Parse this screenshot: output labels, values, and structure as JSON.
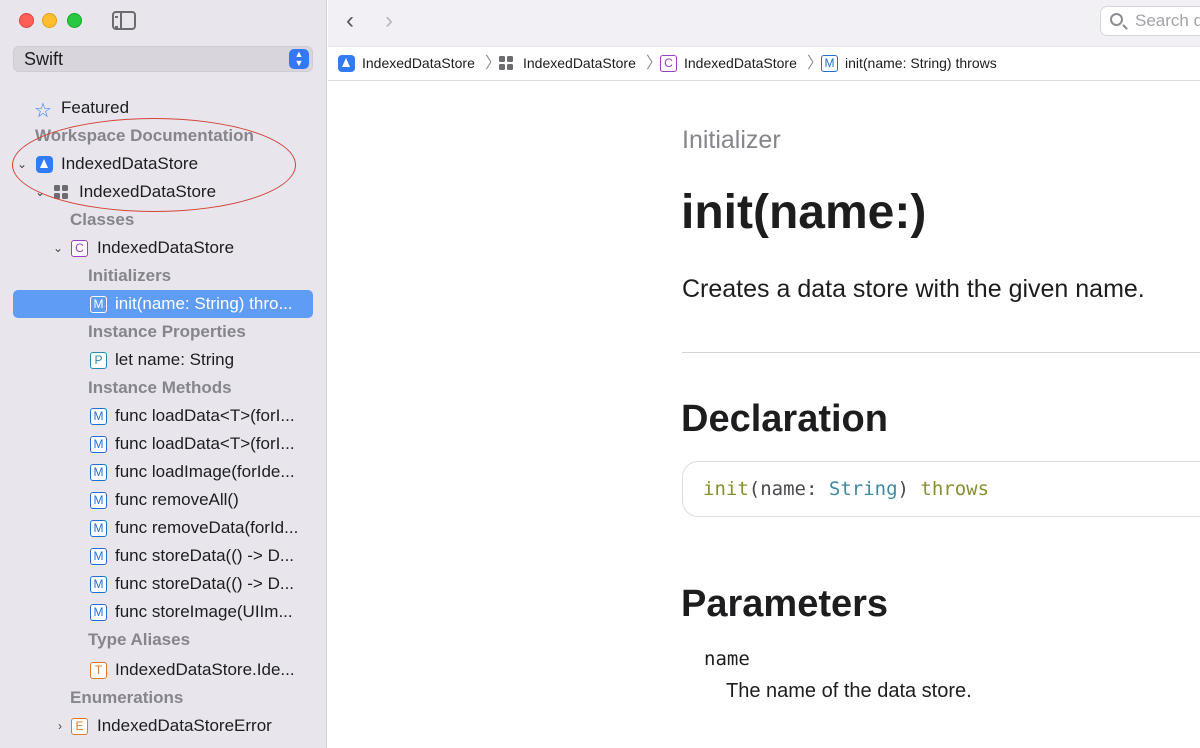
{
  "sidebar": {
    "language": "Swift",
    "rows": [
      {
        "kind": "featured",
        "label": "Featured"
      },
      {
        "kind": "header",
        "label": "Workspace Documentation"
      },
      {
        "kind": "app",
        "label": "IndexedDataStore"
      },
      {
        "kind": "module",
        "label": "IndexedDataStore"
      },
      {
        "kind": "header",
        "label": "Classes"
      },
      {
        "kind": "class",
        "icon": "C",
        "label": "IndexedDataStore"
      },
      {
        "kind": "header",
        "label": "Initializers"
      },
      {
        "kind": "method",
        "icon": "M",
        "label": "init(name: String) thro..."
      },
      {
        "kind": "header",
        "label": "Instance Properties"
      },
      {
        "kind": "property",
        "icon": "P",
        "label": "let name: String"
      },
      {
        "kind": "header",
        "label": "Instance Methods"
      },
      {
        "kind": "method",
        "icon": "M",
        "label": "func loadData<T>(forI..."
      },
      {
        "kind": "method",
        "icon": "M",
        "label": "func loadData<T>(forI..."
      },
      {
        "kind": "method",
        "icon": "M",
        "label": "func loadImage(forIde..."
      },
      {
        "kind": "method",
        "icon": "M",
        "label": "func removeAll()"
      },
      {
        "kind": "method",
        "icon": "M",
        "label": "func removeData(forId..."
      },
      {
        "kind": "method",
        "icon": "M",
        "label": "func storeData(() -> D..."
      },
      {
        "kind": "method",
        "icon": "M",
        "label": "func storeData(() -> D..."
      },
      {
        "kind": "method",
        "icon": "M",
        "label": "func storeImage(UIIm..."
      },
      {
        "kind": "header",
        "label": "Type Aliases"
      },
      {
        "kind": "typealias",
        "icon": "T",
        "label": "IndexedDataStore.Ide..."
      },
      {
        "kind": "header",
        "label": "Enumerations"
      },
      {
        "kind": "enum",
        "icon": "E",
        "label": "IndexedDataStoreError"
      }
    ]
  },
  "toolbar": {
    "back": "‹",
    "forward": "›",
    "search_placeholder": "Search d"
  },
  "breadcrumb": [
    {
      "icon": "app",
      "label": "IndexedDataStore"
    },
    {
      "icon": "module",
      "label": "IndexedDataStore"
    },
    {
      "icon": "C",
      "label": "IndexedDataStore"
    },
    {
      "icon": "M",
      "label": "init(name: String) throws"
    }
  ],
  "content": {
    "kind": "Initializer",
    "title": "init(name:)",
    "abstract": "Creates a data store with the given name.",
    "declaration_heading": "Declaration",
    "declaration": {
      "init": "init",
      "open": "(",
      "param": "name",
      "colon": ": ",
      "type": "String",
      "close": ")",
      "throws": "throws"
    },
    "parameters_heading": "Parameters",
    "parameter_name": "name",
    "parameter_description": "The name of the data store."
  }
}
